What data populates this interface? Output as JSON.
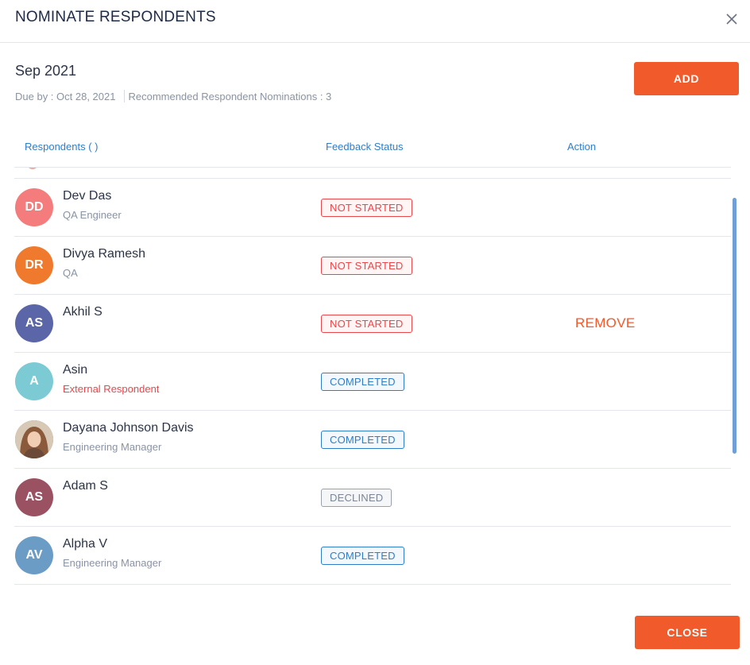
{
  "dialog": {
    "title": "NOMINATE RESPONDENTS",
    "close_icon": "close-icon"
  },
  "summary": {
    "period": "Sep 2021",
    "due_by": "Due by : Oct 28, 2021",
    "recommended": "Recommended Respondent Nominations : 3"
  },
  "buttons": {
    "add_label": "ADD",
    "close_label": "CLOSE"
  },
  "table": {
    "headers": {
      "respondents": "Respondents ( )",
      "feedback_status": "Feedback Status",
      "action": "Action"
    },
    "rows": [
      {
        "initials": "DD",
        "avatar_color": "#f47c7c",
        "name": "Dev Das",
        "subtitle": "QA Engineer",
        "subtitle_type": "role",
        "status": "NOT STARTED",
        "status_type": "not-started",
        "action": ""
      },
      {
        "initials": "DR",
        "avatar_color": "#ef7a2e",
        "name": "Divya Ramesh",
        "subtitle": "QA",
        "subtitle_type": "role",
        "status": "NOT STARTED",
        "status_type": "not-started",
        "action": ""
      },
      {
        "initials": "AS",
        "avatar_color": "#5a66a8",
        "name": "Akhil S",
        "subtitle": "",
        "subtitle_type": "role",
        "status": "NOT STARTED",
        "status_type": "not-started",
        "action": "REMOVE"
      },
      {
        "initials": "A",
        "avatar_color": "#7ccbd4",
        "name": "Asin",
        "subtitle": "External Respondent",
        "subtitle_type": "external",
        "status": "COMPLETED",
        "status_type": "completed",
        "action": ""
      },
      {
        "initials": "",
        "avatar_color": "#8a6a55",
        "avatar_icon": "user-photo",
        "name": "Dayana Johnson Davis",
        "subtitle": "Engineering Manager",
        "subtitle_type": "role",
        "status": "COMPLETED",
        "status_type": "completed",
        "action": ""
      },
      {
        "initials": "AS",
        "avatar_color": "#9a5263",
        "name": "Adam S",
        "subtitle": "",
        "subtitle_type": "role",
        "status": "DECLINED",
        "status_type": "declined",
        "action": ""
      },
      {
        "initials": "AV",
        "avatar_color": "#6b9cc6",
        "name": "Alpha V",
        "subtitle": "Engineering Manager",
        "subtitle_type": "role",
        "status": "COMPLETED",
        "status_type": "completed",
        "action": ""
      }
    ]
  },
  "colors": {
    "accent": "#f15a2b",
    "link_blue": "#2f7dc8",
    "not_started": "#e8474b",
    "declined": "#7d8594"
  }
}
